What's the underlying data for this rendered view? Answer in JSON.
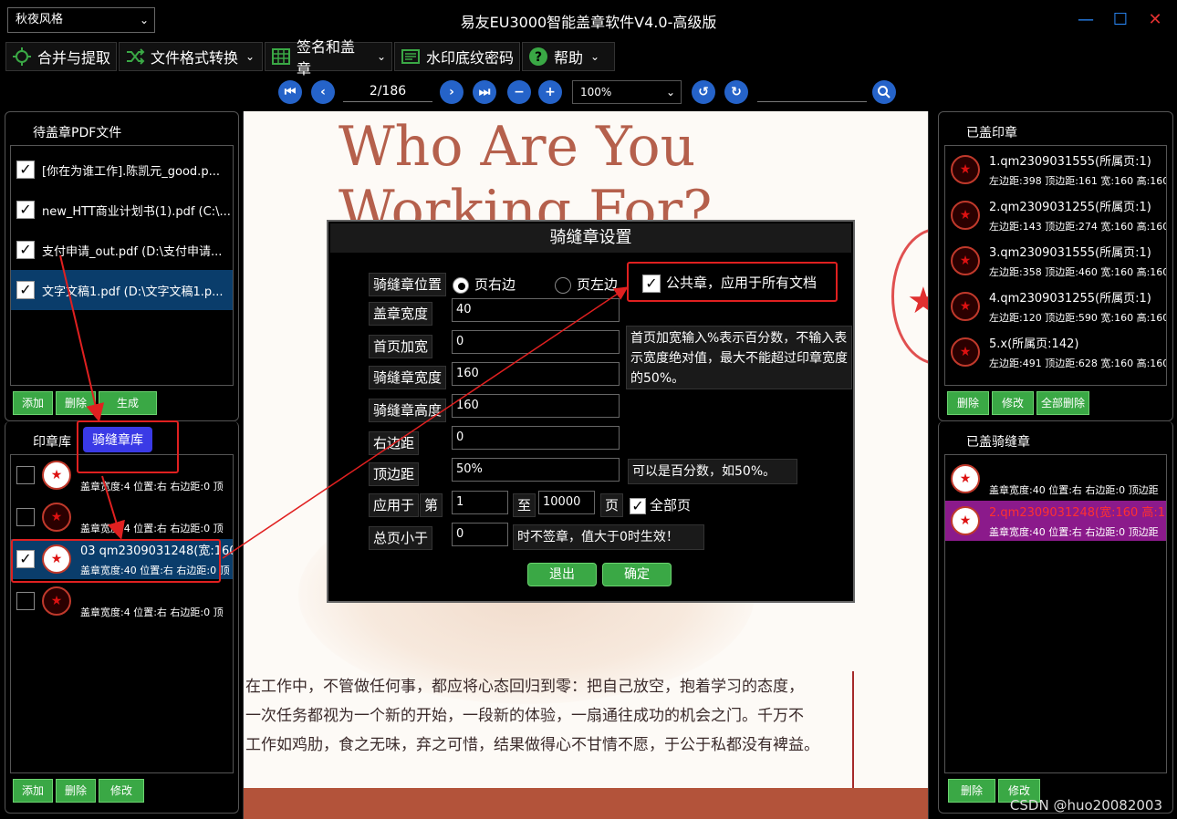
{
  "window": {
    "title": "易友EU3000智能盖章软件V4.0-高级版",
    "theme": "秋夜风格",
    "minimize": "—",
    "maximize": "☐",
    "close": "✕"
  },
  "menu": [
    {
      "label": "合并与提取",
      "icon": "merge-icon",
      "has_dropdown": false
    },
    {
      "label": "文件格式转换",
      "icon": "shuffle-icon",
      "has_dropdown": true
    },
    {
      "label": "签名和盖章",
      "icon": "table-icon",
      "has_dropdown": true
    },
    {
      "label": "水印底纹密码",
      "icon": "watermark-icon",
      "has_dropdown": false
    },
    {
      "label": "帮助",
      "icon": "help-icon",
      "has_dropdown": true
    }
  ],
  "toolbar": {
    "page": "2/186",
    "zoom": "100%",
    "search_value": ""
  },
  "left_files": {
    "title": "待盖章PDF文件",
    "items": [
      {
        "label": "[你在为谁工作].陈凯元_good.p...",
        "checked": true
      },
      {
        "label": "new_HTT商业计划书(1).pdf (C:\\...",
        "checked": true
      },
      {
        "label": "支付申请_out.pdf (D:\\支付申请...",
        "checked": true
      },
      {
        "label": "文字文稿1.pdf (D:\\文字文稿1.p...",
        "checked": true,
        "selected": true
      }
    ],
    "buttons": {
      "add": "添加",
      "delete": "删除",
      "generate": "生成"
    }
  },
  "seal_library": {
    "tab_seal": "印章库",
    "tab_riding": "骑缝章库",
    "items": [
      {
        "title": "",
        "detail": "盖章宽度:4 位置:右 右边距:0 顶",
        "checked": false
      },
      {
        "title": "",
        "detail": "盖章宽度:4 位置:右 右边距:0 顶",
        "checked": false
      },
      {
        "title": "03 qm2309031248(宽:160...",
        "detail": "盖章宽度:40 位置:右 右边距:0 顶",
        "checked": true,
        "selected": true
      },
      {
        "title": "",
        "detail": "盖章宽度:4 位置:右 右边距:0 顶",
        "checked": false
      }
    ],
    "buttons": {
      "add": "添加",
      "delete": "删除",
      "edit": "修改"
    }
  },
  "document": {
    "heading_line1": "Who Are You",
    "heading_line2": "Working For?",
    "text_lines": [
      "在工作中，不管做任何事，都应将心态回归到零：把自己放空，抱着学习的态度，",
      "一次任务都视为一个新的开始，一段新的体验，一扇通往成功的机会之门。千万不",
      "工作如鸡肋，食之无味，弃之可惜，结果做得心不甘情不愿，于公于私都没有裨益。"
    ]
  },
  "dialog": {
    "title": "骑缝章设置",
    "position_label": "骑缝章位置",
    "radio_right": "页右边",
    "radio_left": "页左边",
    "public_seal": "公共章，应用于所有文档",
    "fields": [
      {
        "label": "盖章宽度",
        "value": "40"
      },
      {
        "label": "首页加宽",
        "value": "0"
      },
      {
        "label": "骑缝章宽度",
        "value": "160"
      },
      {
        "label": "骑缝章高度",
        "value": "160"
      },
      {
        "label": "右边距",
        "value": "0"
      },
      {
        "label": "顶边距",
        "value": "50%"
      }
    ],
    "note_first_page": "首页加宽输入%表示百分数，不输入表示宽度绝对值，最大不能超过印章宽度的50%。",
    "note_top": "可以是百分数，如50%。",
    "apply_label": "应用于",
    "apply_from_label": "第",
    "apply_from": "1",
    "apply_to_label": "至",
    "apply_to": "10000",
    "apply_page_label": "页",
    "all_pages": "全部页",
    "min_pages_label": "总页小于",
    "min_pages": "0",
    "min_pages_note": "时不签章，值大于0时生效！",
    "exit": "退出",
    "ok": "确定"
  },
  "stamped": {
    "title": "已盖印章",
    "items": [
      {
        "title": "1.qm2309031555(所属页:1)",
        "detail": "左边距:398 顶边距:161 宽:160 高:160"
      },
      {
        "title": "2.qm2309031255(所属页:1)",
        "detail": "左边距:143 顶边距:274 宽:160 高:160"
      },
      {
        "title": "3.qm2309031555(所属页:1)",
        "detail": "左边距:358 顶边距:460 宽:160 高:160"
      },
      {
        "title": "4.qm2309031255(所属页:1)",
        "detail": "左边距:120 顶边距:590 宽:160 高:160"
      },
      {
        "title": "5.x(所属页:142)",
        "detail": "左边距:491 顶边距:628 宽:160 高:160"
      }
    ],
    "buttons": {
      "delete": "删除",
      "edit": "修改",
      "delete_all": "全部删除"
    }
  },
  "riding_stamped": {
    "title": "已盖骑缝章",
    "items": [
      {
        "title": "",
        "detail": "盖章宽度:40 位置:右 右边距:0 顶边距"
      },
      {
        "title": "2.qm2309031248(宽:160 高:160)",
        "detail": "盖章宽度:40 位置:右 右边距:0 顶边距",
        "selected": true
      }
    ],
    "buttons": {
      "delete": "删除",
      "edit": "修改"
    }
  },
  "watermark": "CSDN @huo20082003",
  "colors": {
    "accent": "#2563c9",
    "button_green": "#3aa845",
    "selection": "#0a3d6b",
    "highlight_purple": "#8b1a8b",
    "annotation_red": "#e02020"
  }
}
